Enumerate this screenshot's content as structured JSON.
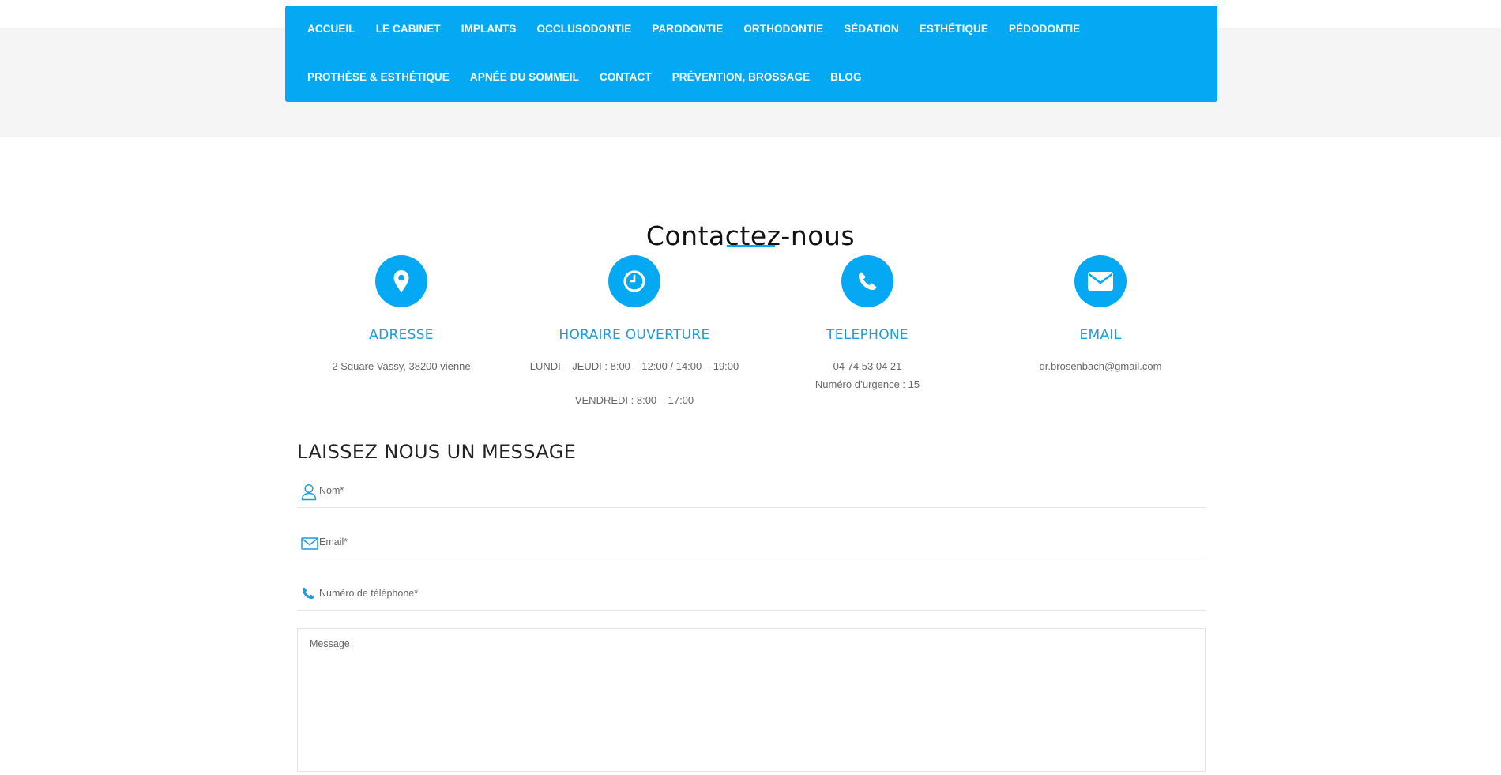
{
  "nav": {
    "row1": [
      "ACCUEIL",
      "LE CABINET",
      "IMPLANTS",
      "OCCLUSODONTIE",
      "PARODONTIE",
      "ORTHODONTIE",
      "SÉDATION",
      "ESTHÉTIQUE",
      "PÉDODONTIE"
    ],
    "row2": [
      "PROTHÈSE & ESTHÉTIQUE",
      "APNÉE DU SOMMEIL",
      "CONTACT",
      "PRÉVENTION, BROSSAGE",
      "BLOG"
    ]
  },
  "contact": {
    "title": "Contactez-nous",
    "address": {
      "heading": "ADRESSE",
      "line1": "2 Square Vassy, 38200 vienne",
      "icon": "map-pin-icon"
    },
    "hours": {
      "heading": "HORAIRE OUVERTURE",
      "line1": "LUNDI – JEUDI : 8:00 – 12:00 / 14:00 – 19:00",
      "line2": "VENDREDI : 8:00 – 17:00",
      "icon": "clock-icon"
    },
    "phone": {
      "heading": "TELEPHONE",
      "line1": "04 74 53 04 21",
      "line2": "Numéro d’urgence : 15",
      "icon": "phone-icon"
    },
    "email": {
      "heading": "EMAIL",
      "line1": "dr.brosenbach@gmail.com",
      "icon": "envelope-icon"
    }
  },
  "form": {
    "title": "LAISSEZ NOUS UN MESSAGE",
    "name_placeholder": "Nom*",
    "email_placeholder": "Email*",
    "phone_placeholder": "Numéro de téléphone*",
    "message_placeholder": "Message"
  },
  "colors": {
    "accent": "#05a8f2",
    "heading_accent": "#1c9be0",
    "band": "#f5f5f5"
  }
}
